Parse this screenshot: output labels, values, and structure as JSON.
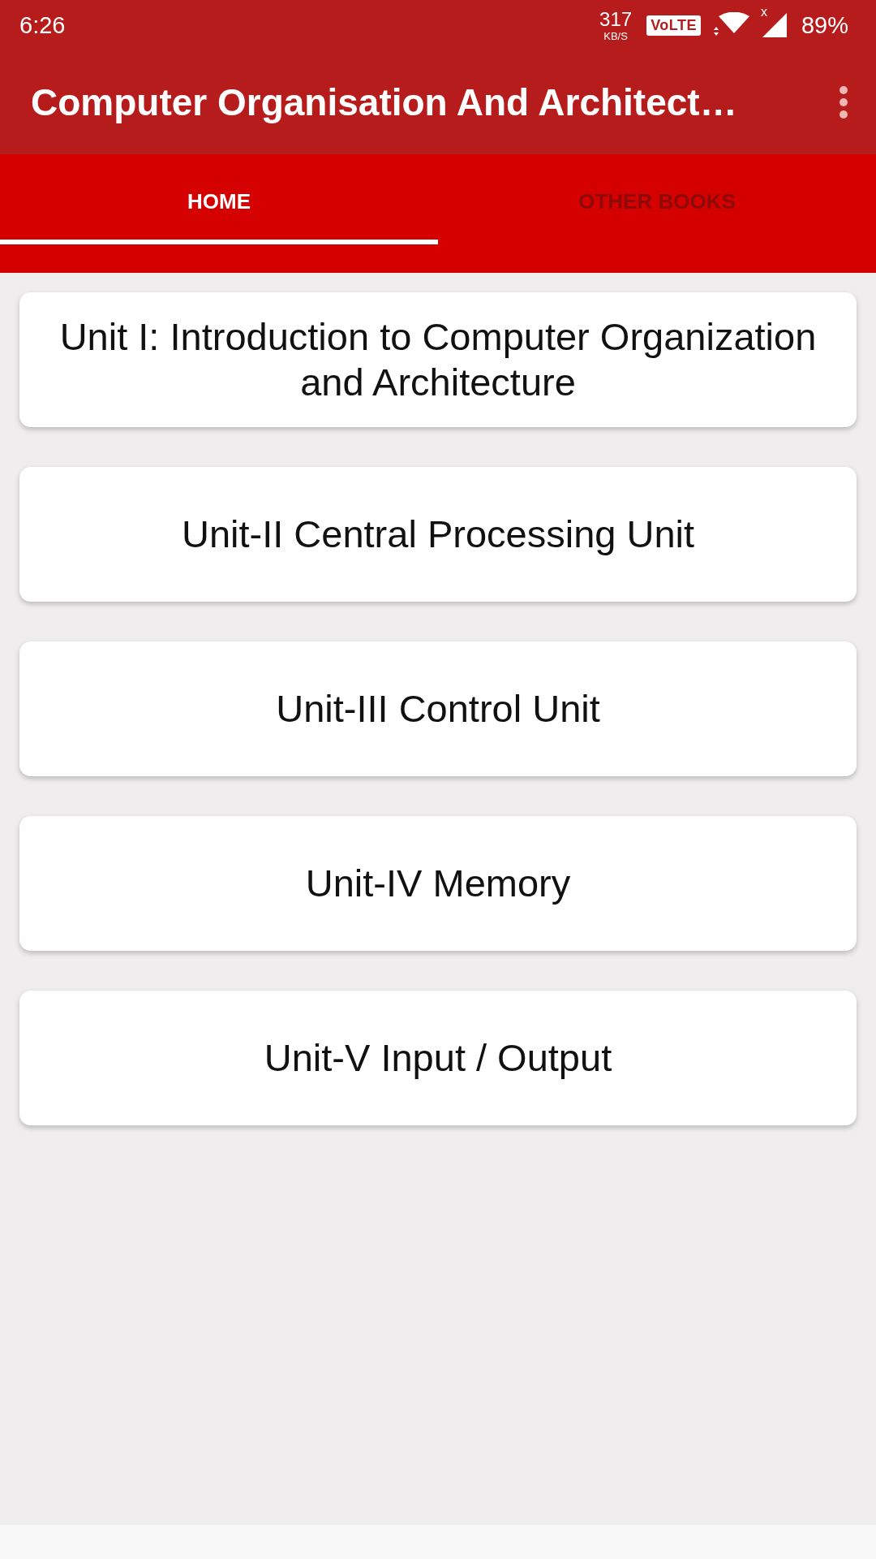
{
  "status_bar": {
    "time": "6:26",
    "net_speed": "317",
    "net_speed_unit": "KB/S",
    "volte_badge": "VoLTE",
    "signal_mark": "x",
    "battery": "89%"
  },
  "app_bar": {
    "title": "Computer Organisation And Architect…"
  },
  "tabs": [
    {
      "label": "HOME",
      "selected": true
    },
    {
      "label": "OTHER BOOKS",
      "selected": false
    }
  ],
  "units": [
    {
      "title": "Unit I: Introduction to Computer Organization and Architecture"
    },
    {
      "title": "Unit-II Central Processing Unit"
    },
    {
      "title": "Unit-III Control Unit"
    },
    {
      "title": "Unit-IV Memory"
    },
    {
      "title": "Unit-V Input / Output"
    }
  ]
}
